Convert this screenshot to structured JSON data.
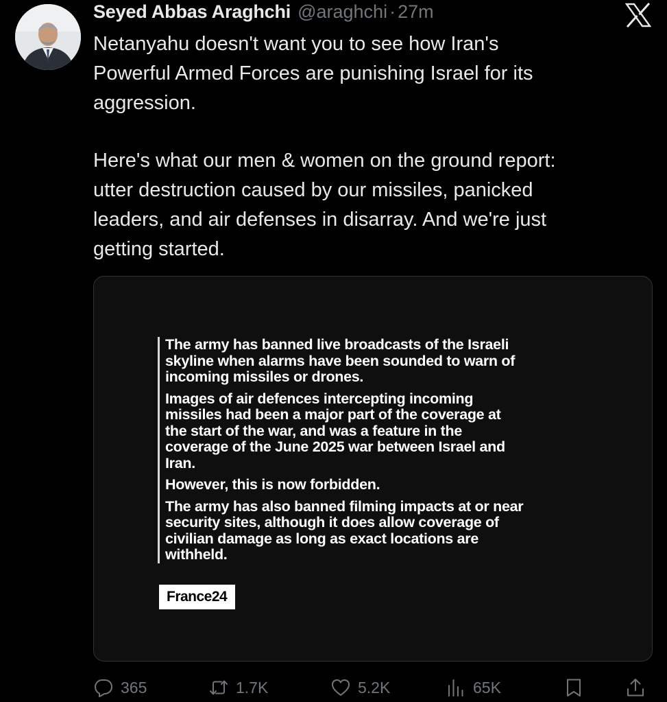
{
  "author": {
    "display_name": "Seyed Abbas Araghchi",
    "handle": "@araghchi",
    "separator": "·",
    "time": "27m",
    "avatar_icon": "profile-photo"
  },
  "platform": {
    "logo_icon": "x-logo"
  },
  "tweet": {
    "paragraphs": [
      "Netanyahu doesn't want you to see how Iran's\nPowerful Armed Forces are punishing Israel for its\naggression.",
      "Here's what our men & women on the ground report:\nutter destruction caused by our missiles, panicked\nleaders, and air defenses in disarray. And we're just\ngetting started."
    ]
  },
  "media": {
    "quote_paragraphs": [
      "The army has banned live broadcasts of the Israeli\nskyline when alarms have been sounded to warn of\nincoming missiles or drones.",
      "Images of air defences intercepting incoming\nmissiles had been a major part of the coverage at\nthe start of the war, and was a feature in the\ncoverage of the June 2025 war between Israel and\nIran.",
      "However, this is now forbidden.",
      "The army has also banned filming impacts at or near\nsecurity sites, although it does allow coverage of\ncivilian damage as long as exact locations are\nwithheld."
    ],
    "source": "France24"
  },
  "actions": {
    "replies": {
      "icon": "reply-icon",
      "count": "365"
    },
    "reposts": {
      "icon": "repost-icon",
      "count": "1.7K"
    },
    "likes": {
      "icon": "heart-icon",
      "count": "5.2K"
    },
    "views": {
      "icon": "views-icon",
      "count": "65K"
    },
    "bookmark": {
      "icon": "bookmark-icon"
    },
    "share": {
      "icon": "share-icon"
    }
  },
  "colors": {
    "background": "#000000",
    "text": "#e7e9ea",
    "muted": "#71767b",
    "card_border": "#2f3336"
  }
}
